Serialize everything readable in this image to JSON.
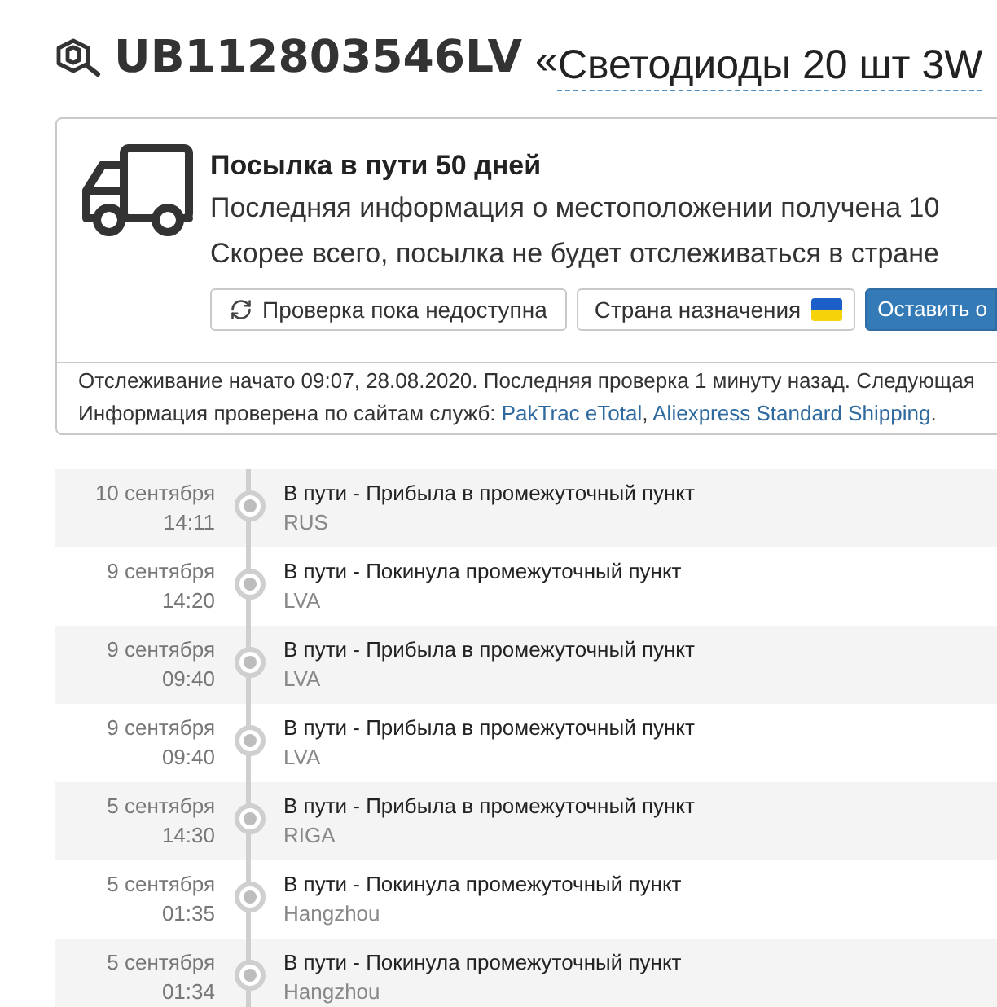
{
  "header": {
    "tracking_number": "UB112803546LV",
    "quote": "«",
    "item_title": "Светодиоды 20 шт 3W"
  },
  "status_card": {
    "title": "Посылка в пути 50 дней",
    "lines": [
      "Последняя информация о местоположении получена 10",
      "Скорее всего, посылка не будет отслеживаться в стране"
    ],
    "buttons": [
      {
        "kind": "refresh",
        "label": "Проверка пока недоступна"
      },
      {
        "kind": "flag",
        "label": "Страна назначения"
      },
      {
        "kind": "primary",
        "label": "Оставить о"
      }
    ]
  },
  "tracking_info": {
    "started": "Отслеживание начато 09:07, 28.08.2020. Последняя проверка 1 минуту назад. Следующая",
    "sources_label": "Информация проверена по сайтам служб: ",
    "sources": [
      {
        "name": "PakTrac eTotal",
        "trailing": ", "
      },
      {
        "name": "Aliexpress Standard Shipping",
        "trailing": "."
      }
    ]
  },
  "events": [
    {
      "date": "10 сентября",
      "time": "14:11",
      "status": "В пути - Прибыла в промежуточный пункт",
      "location": "RUS"
    },
    {
      "date": "9 сентября",
      "time": "14:20",
      "status": "В пути - Покинула промежуточный пункт",
      "location": "LVA"
    },
    {
      "date": "9 сентября",
      "time": "09:40",
      "status": "В пути - Прибыла в промежуточный пункт",
      "location": "LVA"
    },
    {
      "date": "9 сентября",
      "time": "09:40",
      "status": "В пути - Прибыла в промежуточный пункт",
      "location": "LVA"
    },
    {
      "date": "5 сентября",
      "time": "14:30",
      "status": "В пути - Прибыла в промежуточный пункт",
      "location": "RIGA"
    },
    {
      "date": "5 сентября",
      "time": "01:35",
      "status": "В пути - Покинула промежуточный пункт",
      "location": "Hangzhou"
    },
    {
      "date": "5 сентября",
      "time": "01:34",
      "status": "В пути - Покинула промежуточный пункт",
      "location": "Hangzhou"
    }
  ]
}
